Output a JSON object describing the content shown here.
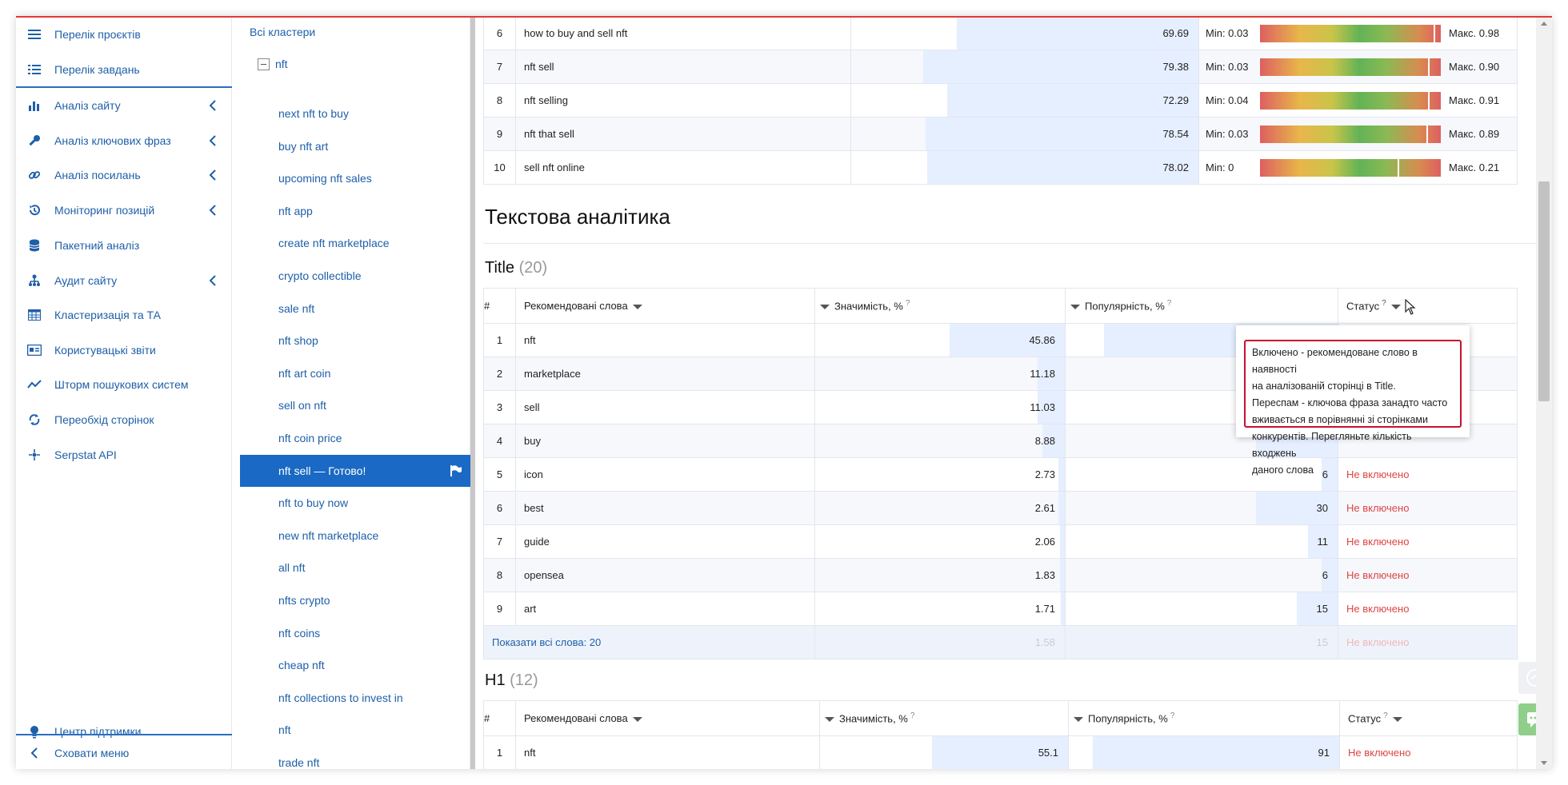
{
  "sidebar": {
    "items": [
      {
        "label": "Перелік проєктів",
        "icon": "menu-lines-icon",
        "chevron": false
      },
      {
        "label": "Перелік завдань",
        "icon": "list-icon",
        "chevron": false
      },
      {
        "label": "Аналіз сайту",
        "icon": "chart-icon",
        "chevron": true
      },
      {
        "label": "Аналіз ключових фраз",
        "icon": "key-icon",
        "chevron": true
      },
      {
        "label": "Аналіз посилань",
        "icon": "link-icon",
        "chevron": true
      },
      {
        "label": "Моніторинг позицій",
        "icon": "history-icon",
        "chevron": true
      },
      {
        "label": "Пакетний аналіз",
        "icon": "database-icon",
        "chevron": false
      },
      {
        "label": "Аудит сайту",
        "icon": "sitemap-icon",
        "chevron": true
      },
      {
        "label": "Кластеризація та ТА",
        "icon": "table-icon",
        "chevron": false
      },
      {
        "label": "Користувацькі звіти",
        "icon": "id-card-icon",
        "chevron": false
      },
      {
        "label": "Шторм пошукових систем",
        "icon": "trend-icon",
        "chevron": false
      },
      {
        "label": "Переобхід сторінок",
        "icon": "sync-icon",
        "chevron": false
      },
      {
        "label": "Serpstat API",
        "icon": "api-icon",
        "chevron": false
      }
    ],
    "support_label": "Центр підтримки",
    "hide_menu_label": "Сховати меню"
  },
  "clusters": {
    "header": "Всі кластери",
    "root": "nft",
    "items": [
      "next nft to buy",
      "buy nft art",
      "upcoming nft sales",
      "nft app",
      "create nft marketplace",
      "crypto collectible",
      "sale nft",
      "nft shop",
      "nft art coin",
      "sell on nft",
      "nft coin price",
      "nft sell — Готово!",
      "nft to buy now",
      "new nft marketplace",
      "all nft",
      "nfts crypto",
      "nft coins",
      "cheap nft",
      "nft collections to invest in",
      "nft",
      "trade nft"
    ],
    "active_index": 11
  },
  "top_table": {
    "rows": [
      {
        "n": "6",
        "kw": "how to buy and sell nft",
        "score": "69.69",
        "min": "Min: 0.03",
        "max": "Макс. 0.98",
        "score_fraction": 0.6969,
        "marker": 0.96
      },
      {
        "n": "7",
        "kw": "nft sell",
        "score": "79.38",
        "min": "Min: 0.03",
        "max": "Макс. 0.90",
        "score_fraction": 0.7938,
        "marker": 0.93
      },
      {
        "n": "8",
        "kw": "nft selling",
        "score": "72.29",
        "min": "Min: 0.04",
        "max": "Макс. 0.91",
        "score_fraction": 0.7229,
        "marker": 0.93
      },
      {
        "n": "9",
        "kw": "nft that sell",
        "score": "78.54",
        "min": "Min: 0.03",
        "max": "Макс. 0.89",
        "score_fraction": 0.7854,
        "marker": 0.92
      },
      {
        "n": "10",
        "kw": "sell nft online",
        "score": "78.02",
        "min": "Min: 0",
        "max": "Макс. 0.21",
        "score_fraction": 0.7802,
        "marker": 0.76
      }
    ]
  },
  "text_analytics": {
    "title": "Текстова аналітика",
    "title_section": {
      "label": "Title",
      "count": "(20)"
    },
    "columns": {
      "num": "#",
      "words": "Рекомендовані слова",
      "significance": "Значимість, %",
      "popularity": "Популярність, %",
      "status": "Статус",
      "help": "?"
    },
    "title_rows": [
      {
        "n": "1",
        "word": "nft",
        "sig": "45.86",
        "pop": "",
        "status": "",
        "sig_fraction": 0.46,
        "pop_fraction": 0.86
      },
      {
        "n": "2",
        "word": "marketplace",
        "sig": "11.18",
        "pop": "",
        "status": "",
        "sig_fraction": 0.11,
        "pop_fraction": 0.15
      },
      {
        "n": "3",
        "word": "sell",
        "sig": "11.03",
        "pop": "",
        "status": "",
        "sig_fraction": 0.11,
        "pop_fraction": 0.3
      },
      {
        "n": "4",
        "word": "buy",
        "sig": "8.88",
        "pop": "",
        "status": "",
        "sig_fraction": 0.09,
        "pop_fraction": 0.3
      },
      {
        "n": "5",
        "word": "icon",
        "sig": "2.73",
        "pop": "6",
        "status": "Не включено",
        "sig_fraction": 0.027,
        "pop_fraction": 0.06
      },
      {
        "n": "6",
        "word": "best",
        "sig": "2.61",
        "pop": "30",
        "status": "Не включено",
        "sig_fraction": 0.026,
        "pop_fraction": 0.3
      },
      {
        "n": "7",
        "word": "guide",
        "sig": "2.06",
        "pop": "11",
        "status": "Не включено",
        "sig_fraction": 0.02,
        "pop_fraction": 0.11
      },
      {
        "n": "8",
        "word": "opensea",
        "sig": "1.83",
        "pop": "6",
        "status": "Не включено",
        "sig_fraction": 0.018,
        "pop_fraction": 0.06
      },
      {
        "n": "9",
        "word": "art",
        "sig": "1.71",
        "pop": "15",
        "status": "Не включено",
        "sig_fraction": 0.017,
        "pop_fraction": 0.15
      }
    ],
    "show_all": "Показати всі слова: 20",
    "show_all_ghost": {
      "sig": "1.58",
      "pop": "15",
      "status": "Не включено"
    },
    "h1_section": {
      "label": "H1",
      "count": "(12)"
    },
    "h1_rows": [
      {
        "n": "1",
        "word": "nft",
        "sig": "55.1",
        "pop": "91",
        "status": "Не включено",
        "sig_fraction": 0.55,
        "pop_fraction": 0.91
      }
    ]
  },
  "tooltip": {
    "lines": [
      "Включено - рекомендоване слово в наявності",
      "на аналізованій сторінці в Title.",
      "Переспам - ключова фраза занадто часто",
      "вживається в порівнянні зі сторінками",
      "конкурентів. Перегляньте кількість входжень",
      "даного слова"
    ]
  },
  "colors": {
    "accent": "#1a69c4",
    "link": "#1e5fa8",
    "danger": "#e04444",
    "tooltip_border": "#c8102e",
    "bar": "#e6efff"
  }
}
